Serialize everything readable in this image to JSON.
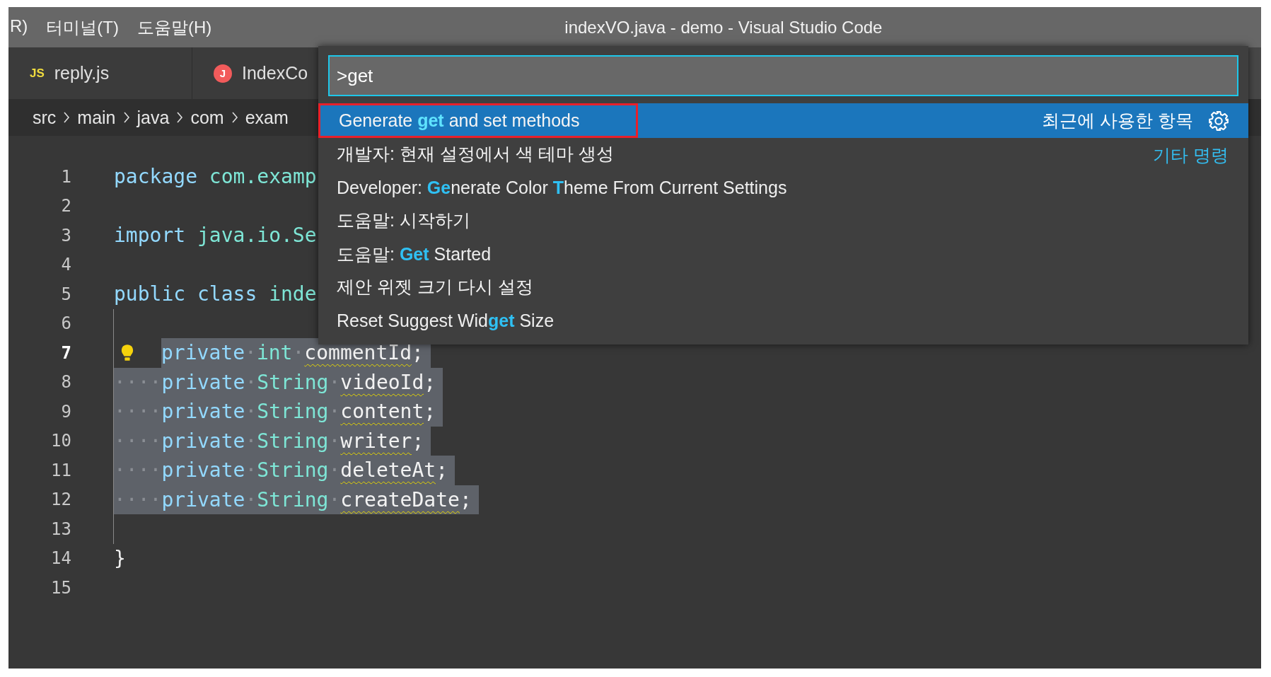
{
  "menu_bar": {
    "items": [
      "R)",
      "터미널(T)",
      "도움말(H)"
    ]
  },
  "window": {
    "title": "indexVO.java - demo - Visual Studio Code"
  },
  "tabs": [
    {
      "icon_text": "JS",
      "kind": "js",
      "label": "reply.js",
      "selected": false
    },
    {
      "icon_text": "J",
      "kind": "java",
      "label": "IndexCo",
      "selected": false
    }
  ],
  "breadcrumb": [
    "src",
    "main",
    "java",
    "com",
    "exam"
  ],
  "editor": {
    "lines": [
      {
        "number": "1",
        "current": false,
        "selected": false,
        "guide": false,
        "lightbulb": false,
        "tokens": [
          {
            "text": "package",
            "kind": "keyword"
          },
          {
            "text": " com.examp",
            "kind": "type"
          }
        ]
      },
      {
        "number": "2",
        "current": false,
        "selected": false,
        "guide": false,
        "lightbulb": false
      },
      {
        "number": "3",
        "current": false,
        "selected": false,
        "guide": false,
        "lightbulb": false,
        "tokens": [
          {
            "text": "import",
            "kind": "keyword"
          },
          {
            "text": " java.io.Se",
            "kind": "type"
          }
        ]
      },
      {
        "number": "4",
        "current": false,
        "selected": false,
        "guide": false,
        "lightbulb": false
      },
      {
        "number": "5",
        "current": false,
        "selected": false,
        "guide": false,
        "lightbulb": false,
        "tokens": [
          {
            "text": "public class",
            "kind": "keyword"
          },
          {
            "text": " inde",
            "kind": "type"
          }
        ]
      },
      {
        "number": "6",
        "current": false,
        "selected": false,
        "guide": true,
        "lightbulb": false
      },
      {
        "number": "7",
        "current": true,
        "selected": true,
        "guide": true,
        "lightbulb": true,
        "tokens": [
          {
            "text": "private",
            "kind": "keyword"
          },
          {
            "text": "·",
            "kind": "ws"
          },
          {
            "text": "int",
            "kind": "type"
          },
          {
            "text": "·",
            "kind": "ws"
          },
          {
            "text": "commentId",
            "kind": "warn"
          },
          {
            "text": ";",
            "kind": "punct"
          }
        ]
      },
      {
        "number": "8",
        "current": false,
        "selected": true,
        "guide": true,
        "lightbulb": false,
        "tokens": [
          {
            "text": "····",
            "kind": "ws"
          },
          {
            "text": "private",
            "kind": "keyword"
          },
          {
            "text": "·",
            "kind": "ws"
          },
          {
            "text": "String",
            "kind": "type"
          },
          {
            "text": "·",
            "kind": "ws"
          },
          {
            "text": "videoId",
            "kind": "warn"
          },
          {
            "text": ";",
            "kind": "punct"
          }
        ]
      },
      {
        "number": "9",
        "current": false,
        "selected": true,
        "guide": true,
        "lightbulb": false,
        "tokens": [
          {
            "text": "····",
            "kind": "ws"
          },
          {
            "text": "private",
            "kind": "keyword"
          },
          {
            "text": "·",
            "kind": "ws"
          },
          {
            "text": "String",
            "kind": "type"
          },
          {
            "text": "·",
            "kind": "ws"
          },
          {
            "text": "content",
            "kind": "warn"
          },
          {
            "text": ";",
            "kind": "punct"
          }
        ]
      },
      {
        "number": "10",
        "current": false,
        "selected": true,
        "guide": true,
        "lightbulb": false,
        "tokens": [
          {
            "text": "····",
            "kind": "ws"
          },
          {
            "text": "private",
            "kind": "keyword"
          },
          {
            "text": "·",
            "kind": "ws"
          },
          {
            "text": "String",
            "kind": "type"
          },
          {
            "text": "·",
            "kind": "ws"
          },
          {
            "text": "writer",
            "kind": "warn"
          },
          {
            "text": ";",
            "kind": "punct"
          }
        ]
      },
      {
        "number": "11",
        "current": false,
        "selected": true,
        "guide": true,
        "lightbulb": false,
        "tokens": [
          {
            "text": "····",
            "kind": "ws"
          },
          {
            "text": "private",
            "kind": "keyword"
          },
          {
            "text": "·",
            "kind": "ws"
          },
          {
            "text": "String",
            "kind": "type"
          },
          {
            "text": "·",
            "kind": "ws"
          },
          {
            "text": "deleteAt",
            "kind": "warn"
          },
          {
            "text": ";",
            "kind": "punct"
          }
        ]
      },
      {
        "number": "12",
        "current": false,
        "selected": true,
        "guide": true,
        "lightbulb": false,
        "tokens": [
          {
            "text": "····",
            "kind": "ws"
          },
          {
            "text": "private",
            "kind": "keyword"
          },
          {
            "text": "·",
            "kind": "ws"
          },
          {
            "text": "String",
            "kind": "type"
          },
          {
            "text": "·",
            "kind": "ws"
          },
          {
            "text": "createDate",
            "kind": "warn"
          },
          {
            "text": ";",
            "kind": "punct"
          }
        ]
      },
      {
        "number": "13",
        "current": false,
        "selected": false,
        "guide": true,
        "lightbulb": false
      },
      {
        "number": "14",
        "current": false,
        "selected": false,
        "guide": false,
        "lightbulb": false,
        "tokens": [
          {
            "text": "}",
            "kind": "punct"
          }
        ]
      },
      {
        "number": "15",
        "current": false,
        "selected": false,
        "guide": false,
        "lightbulb": false
      }
    ]
  },
  "command_palette": {
    "input": {
      "value": ">get"
    },
    "items": [
      {
        "label": "Generate **get** and set methods",
        "group_label": "최근에 사용한 항목",
        "selected": true,
        "annotated": true
      },
      {
        "label": "개발자: 현재 설정에서 색 테마 생성",
        "detail": "Developer: **Ge**nerate Color **T**heme From Current Settings",
        "group_label": "기타 명령",
        "selected": false,
        "annotated": false
      },
      {
        "label": "도움말: 시작하기",
        "detail": "도움말: **Get** Started",
        "selected": false,
        "annotated": false
      },
      {
        "label": "제안 위젯 크기 다시 설정",
        "detail": "Reset Suggest Wid**get** Size",
        "selected": false,
        "annotated": false
      }
    ]
  }
}
